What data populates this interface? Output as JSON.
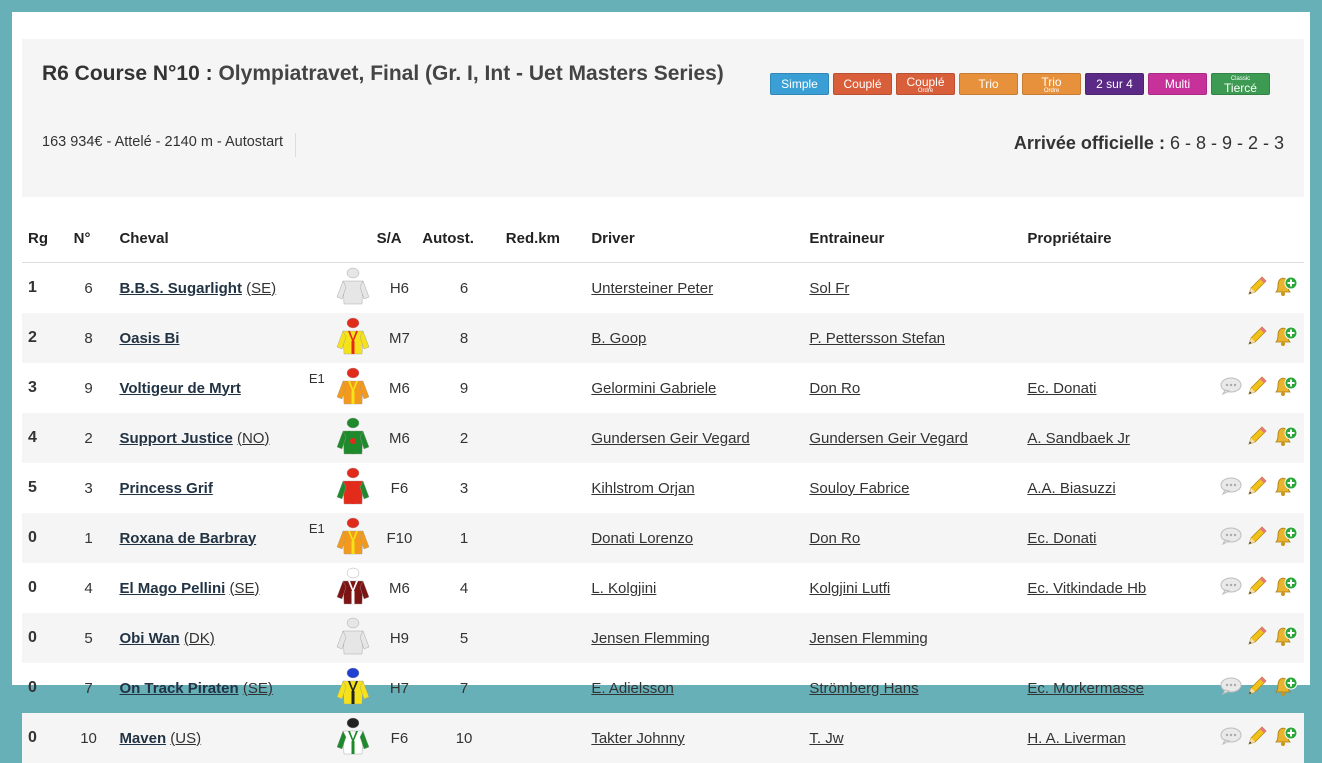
{
  "header": {
    "race_code": "R6 Course N°10 :",
    "race_name": "Olympiatravet, Final (Gr. I, Int - Uet Masters Series)",
    "info": "163 934€ - Attelé - 2140 m - Autostart",
    "arrivee_label": "Arrivée officielle :",
    "arrivee_value": "6 - 8 - 9 - 2 - 3"
  },
  "bets": [
    {
      "label": "Simple",
      "small": "",
      "color": "#3a9fd5"
    },
    {
      "label": "Couplé",
      "small": "",
      "color": "#d95f3a"
    },
    {
      "label": "Couplé",
      "small": "Ordre",
      "color": "#d95f3a"
    },
    {
      "label": "Trio",
      "small": "",
      "color": "#e8913c"
    },
    {
      "label": "Trio",
      "small": "Ordre",
      "color": "#e8913c"
    },
    {
      "label": "2 sur 4",
      "small": "",
      "color": "#5b2a86"
    },
    {
      "label": "Multi",
      "small": "",
      "color": "#c7319a"
    },
    {
      "label": "Tiercé",
      "small": "Classic",
      "color": "#3d9a52"
    }
  ],
  "columns": {
    "rg": "Rg",
    "num": "N°",
    "horse": "Cheval",
    "sa": "S/A",
    "autost": "Autost.",
    "redkm": "Red.km",
    "driver": "Driver",
    "trainer": "Entraineur",
    "owner": "Propriétaire"
  },
  "runners": [
    {
      "rg": "1",
      "num": "6",
      "horse": "B.B.S. Sugarlight",
      "country": "(SE)",
      "ecurie": "",
      "sa": "H6",
      "autost": "6",
      "redkm": "",
      "driver": "Untersteiner Peter",
      "trainer": "Sol Fr",
      "owner": "",
      "comment": false,
      "silk": "none"
    },
    {
      "rg": "2",
      "num": "8",
      "horse": "Oasis Bi",
      "country": "",
      "ecurie": "",
      "sa": "M7",
      "autost": "8",
      "redkm": "",
      "driver": "B. Goop",
      "trainer": "P. Pettersson Stefan",
      "owner": "",
      "comment": false,
      "silk": "yellow-red"
    },
    {
      "rg": "3",
      "num": "9",
      "horse": "Voltigeur de Myrt",
      "country": "",
      "ecurie": "E1",
      "sa": "M6",
      "autost": "9",
      "redkm": "",
      "driver": "Gelormini Gabriele",
      "trainer": "Don Ro",
      "owner": "Ec. Donati",
      "comment": true,
      "silk": "orange-yellow"
    },
    {
      "rg": "4",
      "num": "2",
      "horse": "Support Justice",
      "country": "(NO)",
      "ecurie": "",
      "sa": "M6",
      "autost": "2",
      "redkm": "",
      "driver": "Gundersen Geir Vegard",
      "trainer": "Gundersen Geir Vegard",
      "owner": "A. Sandbaek Jr",
      "comment": false,
      "silk": "green-red"
    },
    {
      "rg": "5",
      "num": "3",
      "horse": "Princess Grif",
      "country": "",
      "ecurie": "",
      "sa": "F6",
      "autost": "3",
      "redkm": "",
      "driver": "Kihlstrom Orjan",
      "trainer": "Souloy Fabrice",
      "owner": "A.A. Biasuzzi",
      "comment": true,
      "silk": "red-green"
    },
    {
      "rg": "0",
      "num": "1",
      "horse": "Roxana de Barbray",
      "country": "",
      "ecurie": "E1",
      "sa": "F10",
      "autost": "1",
      "redkm": "",
      "driver": "Donati Lorenzo",
      "trainer": "Don Ro",
      "owner": "Ec. Donati",
      "comment": true,
      "silk": "orange-yellow"
    },
    {
      "rg": "0",
      "num": "4",
      "horse": "El Mago Pellini",
      "country": "(SE)",
      "ecurie": "",
      "sa": "M6",
      "autost": "4",
      "redkm": "",
      "driver": "L. Kolgjini",
      "trainer": "Kolgjini Lutfi",
      "owner": "Ec. Vitkindade Hb",
      "comment": true,
      "silk": "maroon-white"
    },
    {
      "rg": "0",
      "num": "5",
      "horse": "Obi Wan",
      "country": "(DK)",
      "ecurie": "",
      "sa": "H9",
      "autost": "5",
      "redkm": "",
      "driver": "Jensen Flemming",
      "trainer": "Jensen Flemming",
      "owner": "",
      "comment": false,
      "silk": "none"
    },
    {
      "rg": "0",
      "num": "7",
      "horse": "On Track Piraten",
      "country": "(SE)",
      "ecurie": "",
      "sa": "H7",
      "autost": "7",
      "redkm": "",
      "driver": "E. Adielsson",
      "trainer": "Strömberg Hans",
      "owner": "Ec. Morkermasse",
      "comment": true,
      "silk": "yellow-blue"
    },
    {
      "rg": "0",
      "num": "10",
      "horse": "Maven",
      "country": "(US)",
      "ecurie": "",
      "sa": "F6",
      "autost": "10",
      "redkm": "",
      "driver": "Takter Johnny",
      "trainer": "T. Jw",
      "owner": "H. A. Liverman",
      "comment": true,
      "silk": "white-green"
    }
  ]
}
